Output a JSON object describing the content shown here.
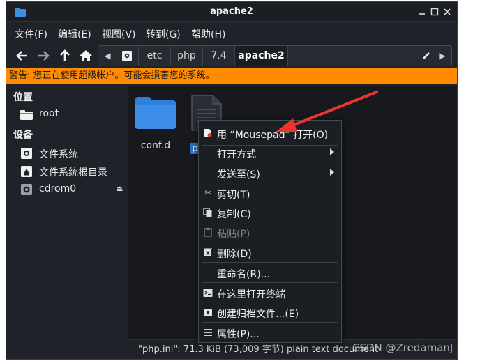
{
  "window": {
    "title": "apache2"
  },
  "menubar": {
    "items": [
      "文件(F)",
      "编辑(E)",
      "视图(V)",
      "转到(G)",
      "帮助(H)"
    ]
  },
  "pathbar": {
    "crumbs": [
      "etc",
      "php",
      "7.4",
      "apache2"
    ],
    "active_index": 3
  },
  "warning": {
    "text": "警告: 您正在使用超级帐户。可能会损害您的系统。",
    "color": "#ff8b00"
  },
  "sidebar": {
    "places_heading": "位置",
    "places": [
      {
        "label": "root",
        "icon": "home-folder-icon"
      }
    ],
    "devices_heading": "设备",
    "devices": [
      {
        "label": "文件系统",
        "icon": "drive-icon"
      },
      {
        "label": "文件系统根目录",
        "icon": "drive-root-icon"
      },
      {
        "label": "cdrom0",
        "icon": "optical-drive-icon"
      }
    ]
  },
  "files": [
    {
      "name": "conf.d",
      "icon": "folder-icon",
      "selected": false
    },
    {
      "name": "p",
      "icon": "text-document-icon",
      "selected": true
    }
  ],
  "context_menu": {
    "items": [
      {
        "label": "用 “Mousepad” 打开(O)",
        "icon": "mousepad-icon",
        "submenu": false,
        "disabled": false
      },
      {
        "label": "打开方式",
        "icon": "",
        "submenu": true,
        "disabled": false
      },
      {
        "label": "发送至(S)",
        "icon": "",
        "submenu": true,
        "disabled": false
      },
      {
        "label": "剪切(T)",
        "icon": "scissors-icon",
        "submenu": false,
        "disabled": false
      },
      {
        "label": "复制(C)",
        "icon": "copy-icon",
        "submenu": false,
        "disabled": false
      },
      {
        "label": "粘贴(P)",
        "icon": "paste-icon",
        "submenu": false,
        "disabled": true
      },
      {
        "label": "删除(D)",
        "icon": "trash-icon",
        "submenu": false,
        "disabled": false
      },
      {
        "label": "重命名(R)...",
        "icon": "",
        "submenu": false,
        "disabled": false
      },
      {
        "label": "在这里打开终端",
        "icon": "terminal-icon",
        "submenu": false,
        "disabled": false
      },
      {
        "label": "创建归档文件...(E)",
        "icon": "archive-icon",
        "submenu": false,
        "disabled": false
      },
      {
        "label": "属性(P)...",
        "icon": "properties-icon",
        "submenu": false,
        "disabled": false
      }
    ]
  },
  "statusbar": {
    "text": "\"php.ini\": 71.3 KiB (73,009 字节) plain text document"
  },
  "watermark": {
    "text": "CSDN @ZredamanJ"
  },
  "colors": {
    "accent": "#2c6fc8",
    "folder": "#3d8ee8",
    "arrow": "#e8362f"
  }
}
